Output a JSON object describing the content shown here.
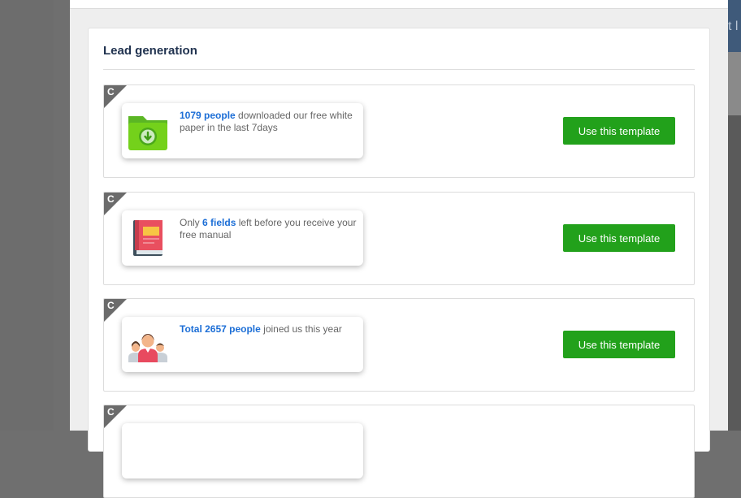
{
  "background": {
    "right_edge_text": "t l"
  },
  "section": {
    "title": "Lead generation"
  },
  "templates": [
    {
      "badge": "C",
      "icon": "folder-download-icon",
      "highlight": "1079 people",
      "text_before": "",
      "text_after": " downloaded our free white paper in the last 7days",
      "button_label": "Use this template"
    },
    {
      "badge": "C",
      "icon": "manual-book-icon",
      "highlight": "6 fields",
      "text_before": "Only ",
      "text_after": " left before you receive your free manual",
      "button_label": "Use this template"
    },
    {
      "badge": "C",
      "icon": "people-group-icon",
      "highlight": "Total 2657 people",
      "text_before": "",
      "text_after": " joined us this year",
      "button_label": "Use this template"
    },
    {
      "badge": "C"
    }
  ],
  "colors": {
    "button": "#22a11b",
    "highlight": "#1c6ed6",
    "title": "#213350",
    "overlay": "#6f6f6f"
  }
}
